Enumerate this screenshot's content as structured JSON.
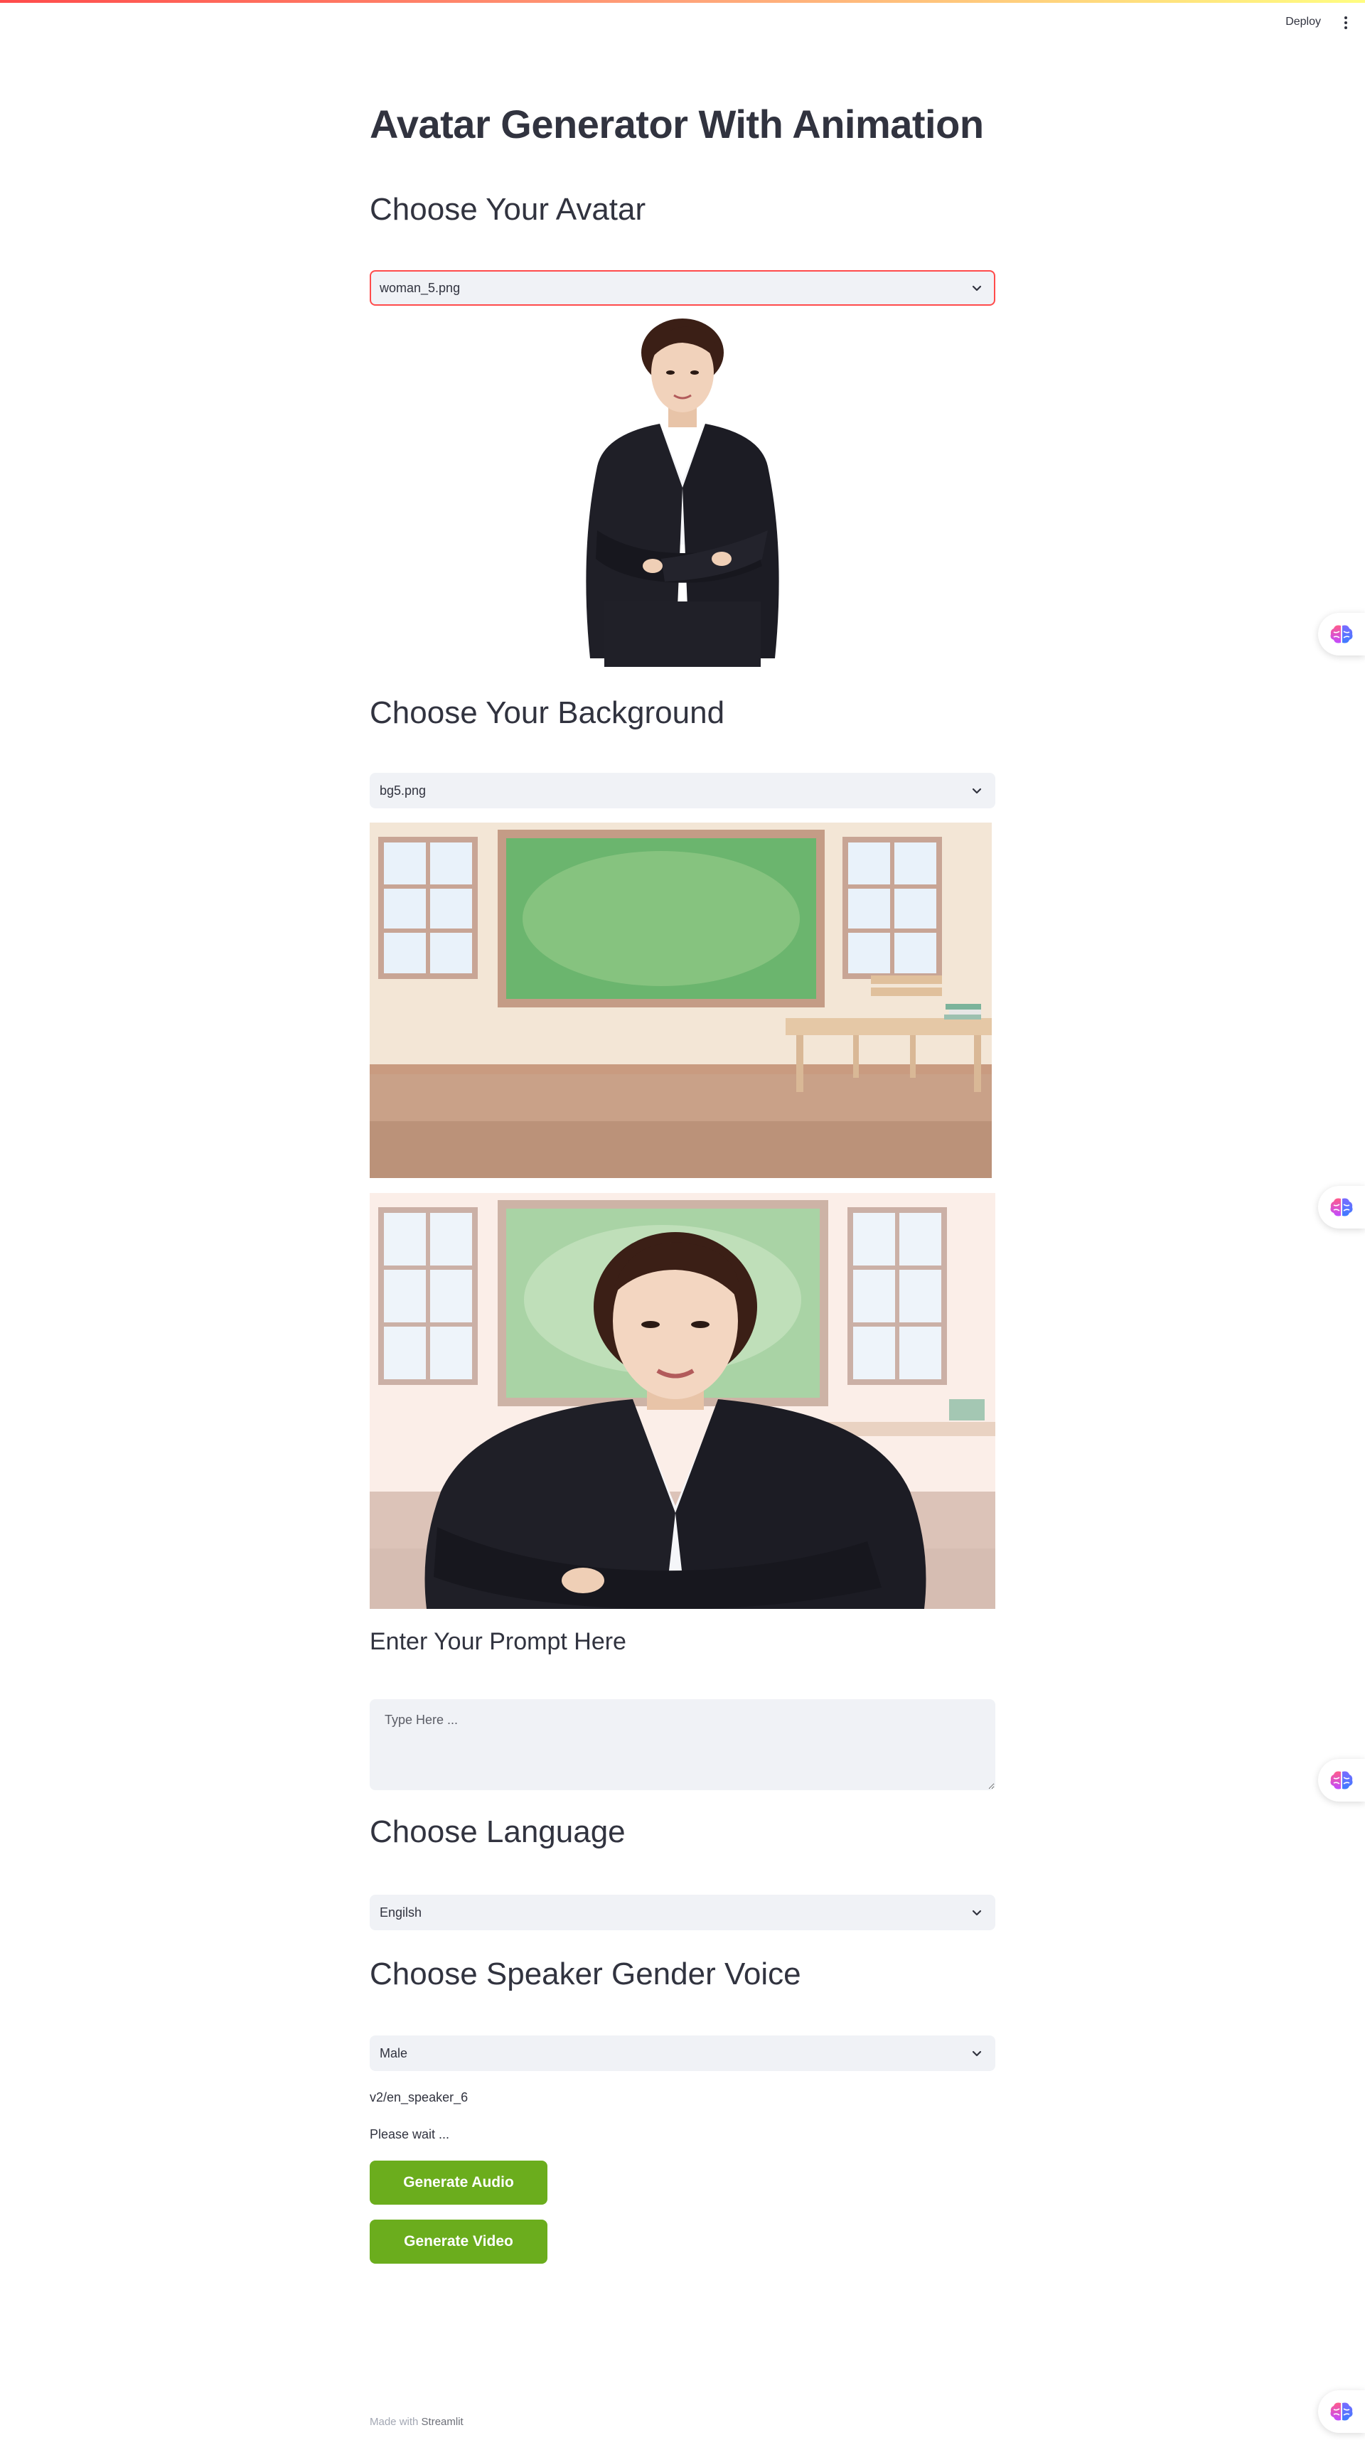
{
  "header": {
    "deploy_label": "Deploy",
    "menu_icon": "more-vertical-icon"
  },
  "page": {
    "title": "Avatar Generator With Animation"
  },
  "avatar_section": {
    "heading": "Choose Your Avatar",
    "selected": "woman_5.png"
  },
  "background_section": {
    "heading": "Choose Your Background",
    "selected": "bg5.png"
  },
  "prompt_section": {
    "heading": "Enter Your Prompt Here",
    "placeholder": "Type Here ...",
    "value": ""
  },
  "language_section": {
    "heading": "Choose Language",
    "selected": "Engilsh"
  },
  "gender_section": {
    "heading": "Choose Speaker Gender Voice",
    "selected": "Male"
  },
  "status": {
    "speaker_id": "v2/en_speaker_6",
    "message": "Please wait ..."
  },
  "buttons": {
    "generate_audio": "Generate Audio",
    "generate_video": "Generate Video"
  },
  "footer": {
    "prefix": "Made with",
    "brand": "Streamlit"
  },
  "colors": {
    "accent": "#ff4b4b",
    "button_green": "#6bad1d",
    "input_bg": "#f0f2f6"
  },
  "side_widgets": {
    "icon": "brain-icon"
  }
}
